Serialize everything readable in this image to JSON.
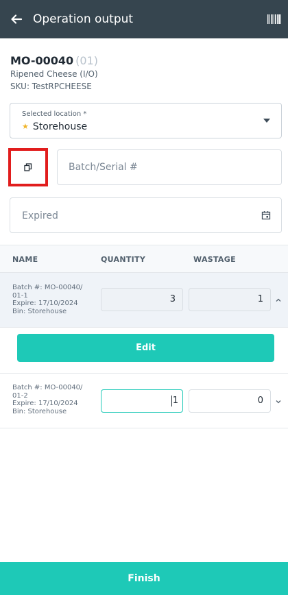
{
  "appbar": {
    "title": "Operation output",
    "back_icon": "arrow-left-icon",
    "barcode_icon": "barcode-icon"
  },
  "order": {
    "mo_code": "MO-00040",
    "mo_suffix": "(01)",
    "product_name": "Ripened Cheese (I/O)",
    "sku": "SKU: TestRPCHEESE"
  },
  "location": {
    "label": "Selected location *",
    "value": "Storehouse",
    "icon": "star-icon"
  },
  "batch": {
    "copy_icon": "copy-icon",
    "placeholder": "Batch/Serial #",
    "value": ""
  },
  "expired": {
    "label": "Expired",
    "icon": "calendar-icon"
  },
  "table": {
    "headers": [
      "NAME",
      "QUANTITY",
      "WASTAGE"
    ],
    "rows": [
      {
        "batch_line1": "Batch #: MO-00040/",
        "batch_line2": "01-1",
        "expire": "Expire: 17/10/2024",
        "bin": "Bin: Storehouse",
        "quantity": "3",
        "wastage": "1",
        "expanded": true
      },
      {
        "batch_line1": "Batch #: MO-00040/",
        "batch_line2": "01-2",
        "expire": "Expire: 17/10/2024",
        "bin": "Bin: Storehouse",
        "quantity": "1",
        "wastage": "0",
        "expanded": false
      }
    ]
  },
  "actions": {
    "edit_label": "Edit",
    "finish_label": "Finish"
  },
  "colors": {
    "appbar": "#36454f",
    "accent": "#1ec9b7",
    "highlight": "#e11d1d",
    "star": "#f0b429"
  }
}
